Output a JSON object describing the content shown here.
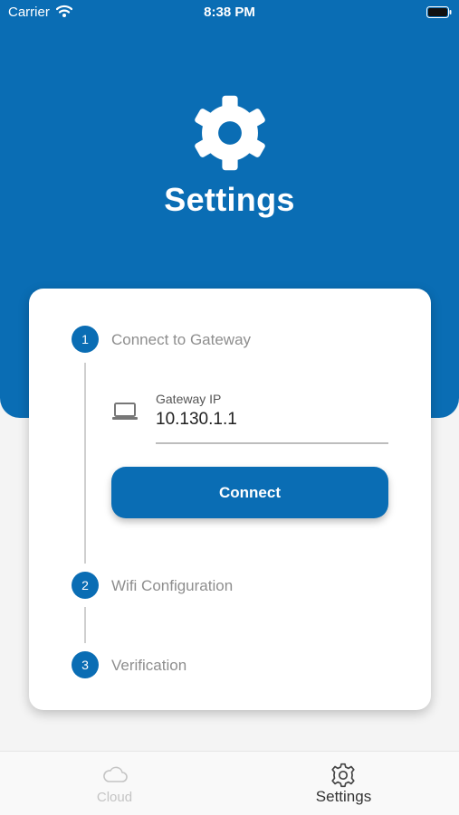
{
  "status_bar": {
    "carrier": "Carrier",
    "time": "8:38 PM"
  },
  "header": {
    "title": "Settings",
    "icon": "gear-icon"
  },
  "steps": [
    {
      "number": "1",
      "label": "Connect to Gateway"
    },
    {
      "number": "2",
      "label": "Wifi Configuration"
    },
    {
      "number": "3",
      "label": "Verification"
    }
  ],
  "gateway": {
    "label": "Gateway IP",
    "value": "10.130.1.1",
    "icon": "laptop-icon"
  },
  "connect_button": {
    "label": "Connect"
  },
  "tabs": [
    {
      "label": "Cloud",
      "icon": "cloud-icon",
      "active": false
    },
    {
      "label": "Settings",
      "icon": "gear-icon",
      "active": true
    }
  ],
  "colors": {
    "primary": "#0a6db4",
    "background": "#f4f4f4",
    "inactive_tab": "#c4c4c4"
  }
}
